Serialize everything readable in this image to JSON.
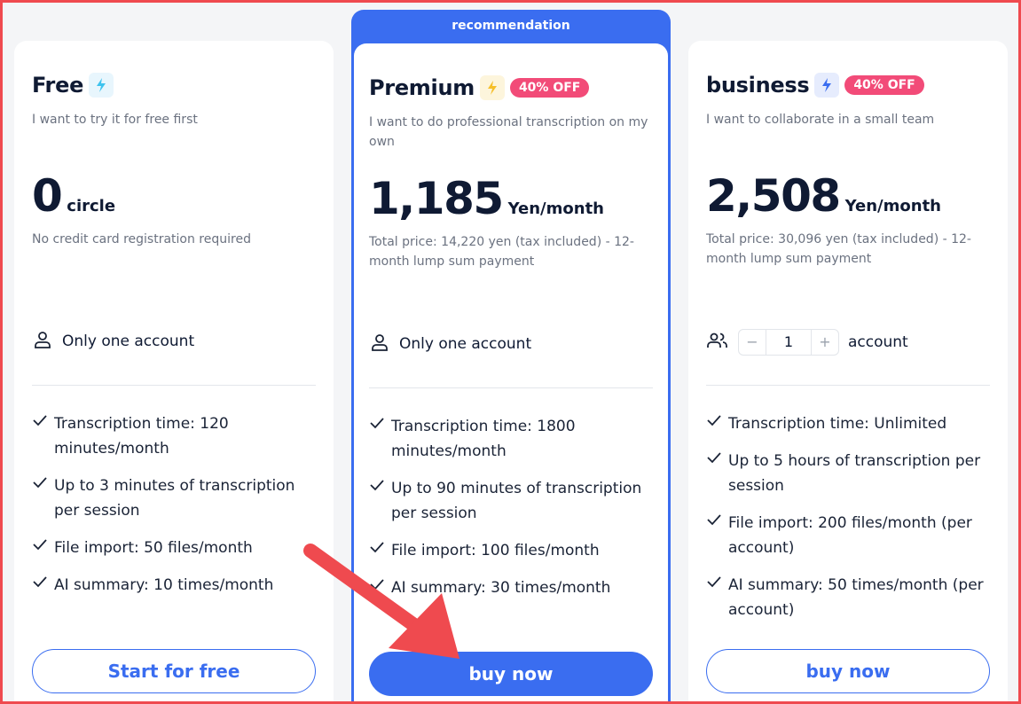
{
  "colors": {
    "accent": "#3a6df0",
    "badge": "#f24b78",
    "annotation": "#ef4a4f"
  },
  "recommendation_label": "recommendation",
  "plans": {
    "free": {
      "name": "Free",
      "icon": "lightning-icon",
      "description": "I want to try it for free first",
      "price": "0",
      "price_unit": "circle",
      "price_note": "No credit card registration required",
      "account_text": "Only one account",
      "features": [
        "Transcription time: 120 minutes/month",
        "Up to 3 minutes of transcription per session",
        "File import: 50 files/month",
        "AI summary: 10 times/month"
      ],
      "cta": "Start for free"
    },
    "premium": {
      "name": "Premium",
      "icon": "lightning-icon",
      "badge": "40% OFF",
      "description": "I want to do professional transcription on my own",
      "price": "1,185",
      "price_unit": "Yen/month",
      "price_note": "Total price: 14,220 yen (tax included) - 12-month lump sum payment",
      "account_text": "Only one account",
      "features": [
        "Transcription time: 1800 minutes/month",
        "Up to 90 minutes of transcription per session",
        "File import: 100 files/month",
        "AI summary: 30 times/month"
      ],
      "cta": "buy now"
    },
    "business": {
      "name": "business",
      "icon": "lightning-icon",
      "badge": "40% OFF",
      "description": "I want to collaborate in a small team",
      "price": "2,508",
      "price_unit": "Yen/month",
      "price_note": "Total price: 30,096 yen (tax included) - 12-month lump sum payment",
      "stepper": {
        "minus": "−",
        "value": "1",
        "plus": "+"
      },
      "account_text": "account",
      "features": [
        "Transcription time: Unlimited",
        "Up to 5 hours of transcription per session",
        "File import: 200 files/month (per account)",
        "AI summary: 50 times/month (per account)"
      ],
      "cta": "buy now"
    }
  }
}
